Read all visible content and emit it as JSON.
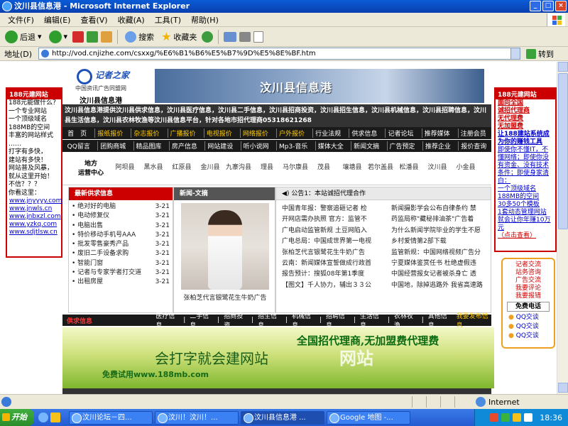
{
  "window": {
    "title": "汶川县信息港 - Microsoft Internet Explorer"
  },
  "menu": [
    "文件(F)",
    "编辑(E)",
    "查看(V)",
    "收藏(A)",
    "工具(T)",
    "帮助(H)"
  ],
  "toolbar": {
    "back": "后退",
    "search": "搜索",
    "favorites": "收藏夹"
  },
  "address": {
    "label": "地址(D)",
    "url": "http://vod.cnjizhe.com/csxxg/%E6%B1%B6%E5%B7%9D%E5%8E%BF.htm",
    "go": "转到"
  },
  "left_ad": {
    "header": "188元建网站",
    "lines": [
      "188元能做什么？",
      "一个专业网站",
      "一个顶级域名",
      "188MB的空间",
      "丰富的网站样式",
      "……",
      "打字有多快，",
      "建站有多快！",
      "网站普及风暴，",
      "就从这里开始！",
      "不信？？？",
      "你看这里："
    ],
    "links": [
      "www.jnyyyy.com",
      "www.jnwls.cn",
      "www.jnbxzl.com",
      "www.yzkq.com",
      "www.sdjtlsw.cn"
    ]
  },
  "right_ad": {
    "header": "188元建网站",
    "links": [
      "面向全国",
      "诚招代理商",
      "无代理费",
      "无加盟费",
      "让188建站系统成",
      "为你的赚钱工具"
    ],
    "lines": [
      "即使你不懂IT，不懂网络；即使你没有资金、没有技术条件；即使身家清白：",
      "一个顶级域名",
      "188MB的空间",
      "30多50个模板",
      "1套动态管理网站",
      "就会让你年赚10万元"
    ],
    "more": "（点击查看）"
  },
  "right_contact": {
    "lines": [
      "记者交流",
      "站务咨询",
      "广告交流",
      "我要评论",
      "我要报错"
    ],
    "phone": "免费电话",
    "qq": [
      "QQ交谈",
      "QQ交谈",
      "QQ交谈"
    ]
  },
  "site": {
    "logo_brand": "记者之家",
    "logo_sub": "中国资讯广告同盟网",
    "logo_city": "汶川县信息港",
    "banner_text": "汶川县信息港",
    "info_line": "汶川县信息港提供汶川县供求信息，汶川县医疗信息，汶川县二手信息，汶川县招商投资，汶川县招生信息，汶川县机械信息，汶川县招聘信息，汶川县生活信息，汶川县农林牧渔等汶川县信息平台，针对各地市招代理商05318621268",
    "nav1": [
      {
        "t": "首　页",
        "hl": false
      },
      {
        "t": "报纸报价",
        "hl": true
      },
      {
        "t": "杂志报价",
        "hl": true
      },
      {
        "t": "广播报价",
        "hl": true
      },
      {
        "t": "电视报价",
        "hl": true
      },
      {
        "t": "网络报价",
        "hl": true
      },
      {
        "t": "户外报价",
        "hl": true
      },
      {
        "t": "行业法规",
        "hl": false
      },
      {
        "t": "供求信息",
        "hl": false
      },
      {
        "t": "记者论坛",
        "hl": false
      },
      {
        "t": "推荐媒体",
        "hl": false
      },
      {
        "t": "注册会员",
        "hl": false
      }
    ],
    "nav2": [
      "QQ留言",
      "团购商城",
      "精品图库",
      "房产信息",
      "网站建设",
      "听小说网",
      "Mp3-音乐",
      "媒体大全",
      "新闻文摘",
      "广告预定",
      "推荐企业",
      "报价查询"
    ],
    "region_label_1": "地方",
    "region_label_2": "运营中心",
    "towns": [
      "阿坝县",
      "黑水县",
      "红原县",
      "金川县",
      "九寨沟县",
      "理县",
      "马尔康县",
      "茂县",
      "壤塘县",
      "若尔盖县",
      "松潘县",
      "汶川县",
      "小金县"
    ]
  },
  "latest_supply": {
    "title": "最新供求信息",
    "items": [
      {
        "t": "绝对好的电脑",
        "d": "3-21"
      },
      {
        "t": "电动修复仪",
        "d": "3-21"
      },
      {
        "t": "电脑出售",
        "d": "3-21"
      },
      {
        "t": "特价移动手机号AAA",
        "d": "3-21"
      },
      {
        "t": "批发零售豪秀产品",
        "d": "3-21"
      },
      {
        "t": "废旧二手设备求购",
        "d": "3-21"
      },
      {
        "t": "智能门窗",
        "d": "3-21"
      },
      {
        "t": "记者与专家学者打交道",
        "d": "3-21"
      },
      {
        "t": "出租房屋",
        "d": "3-21"
      }
    ]
  },
  "news_photo": {
    "title": "新闻-文摘",
    "caption": "张柏芝代言银鹭花生牛奶广告"
  },
  "news": {
    "notice": "公告1：本站诚招代理合作",
    "items": [
      "中国青年报：警察追砸记者 检",
      "新闻摄影学会公布自律条约 禁",
      "开网店需办执照 官方：监管不",
      "药监局称\"藏秘排油茶\"广告着",
      "广电启动监管新规 土豆网陷入",
      "为什么新闻学院毕业的学生不愿",
      "广电总局：中国成世界第一电视",
      "乡村爱情第2部下载",
      "张柏芝代言银鹭花生牛奶广告",
      "监管新规：中国网络视频广告分",
      "云南：新闻媒体宣誓做成行政首",
      "宁夏媒体鉴赏任书 杜绝虚假违",
      "报告预计：搜狐08年第1季度",
      "中国经营报女记者被杀身亡 透",
      "【图文】千人协力，辅出３３公",
      "中国地，除掉逃路外 我省高速路"
    ]
  },
  "supply_bar": {
    "title": "供求信息",
    "items": [
      "医疗信息",
      "二手信息",
      "招商投资",
      "招生信息",
      "机械信息",
      "招聘信息",
      "生活信息",
      "农林牧渔",
      "其他信息"
    ],
    "publish": "我要发布信息"
  },
  "ad_banner": {
    "line1": "全国招代理商,无加盟费代理费",
    "line2": "会打字就会建网站",
    "line3": "免费试用www.188mb.com",
    "ghost": "网站"
  },
  "status": {
    "zone": "Internet"
  },
  "taskbar": {
    "start": "开始",
    "items": [
      "汶川论坛－四...",
      "汶川！汶川！...",
      "汶川县信息港 ...",
      "Google 地图 -..."
    ],
    "clock": "18:36"
  },
  "colors": {
    "accent_red": "#cc0000",
    "nav_highlight": "#ffcc00",
    "xp_blue": "#245bd2"
  }
}
